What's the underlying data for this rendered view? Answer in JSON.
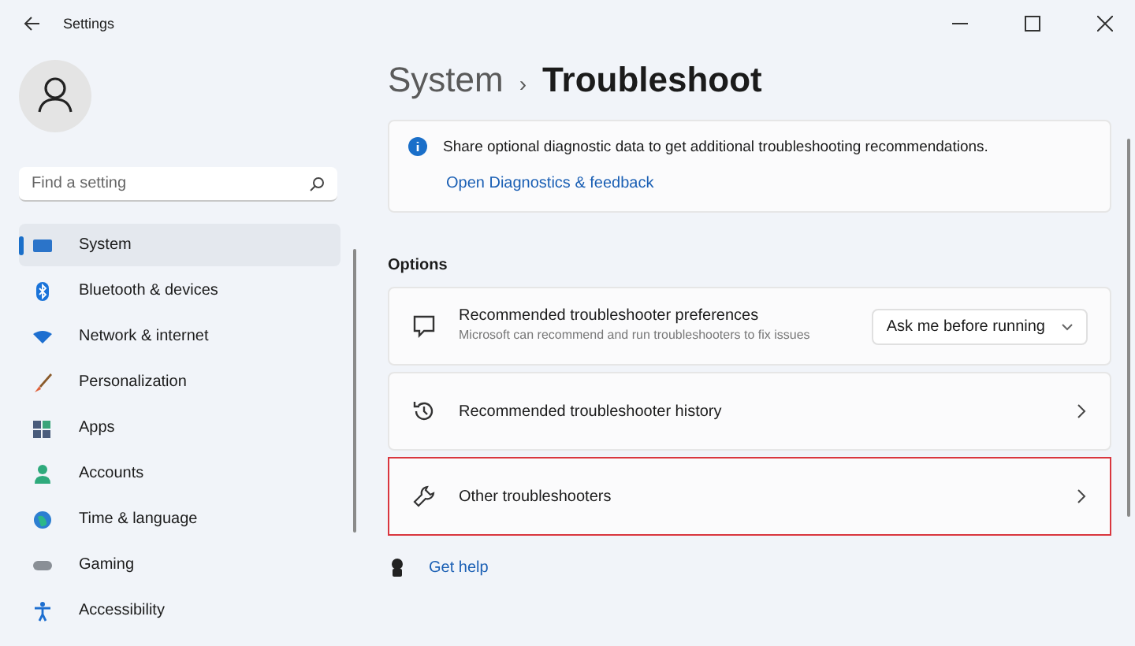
{
  "window": {
    "title": "Settings"
  },
  "sidebar": {
    "search": {
      "placeholder": "Find a setting"
    },
    "items": [
      {
        "label": "System",
        "selected": true
      },
      {
        "label": "Bluetooth & devices",
        "selected": false
      },
      {
        "label": "Network & internet",
        "selected": false
      },
      {
        "label": "Personalization",
        "selected": false
      },
      {
        "label": "Apps",
        "selected": false
      },
      {
        "label": "Accounts",
        "selected": false
      },
      {
        "label": "Time & language",
        "selected": false
      },
      {
        "label": "Gaming",
        "selected": false
      },
      {
        "label": "Accessibility",
        "selected": false
      }
    ]
  },
  "breadcrumb": {
    "parent": "System",
    "separator": "›",
    "current": "Troubleshoot"
  },
  "info": {
    "text": "Share optional diagnostic data to get additional troubleshooting recommendations.",
    "link": "Open Diagnostics & feedback"
  },
  "options": {
    "heading": "Options",
    "items": [
      {
        "kind": "dropdown",
        "title": "Recommended troubleshooter preferences",
        "description": "Microsoft can recommend and run troubleshooters to fix issues",
        "value": "Ask me before running",
        "highlighted": false
      },
      {
        "kind": "link",
        "title": "Recommended troubleshooter history",
        "highlighted": false
      },
      {
        "kind": "link",
        "title": "Other troubleshooters",
        "highlighted": true
      }
    ]
  },
  "help": {
    "label": "Get help"
  }
}
